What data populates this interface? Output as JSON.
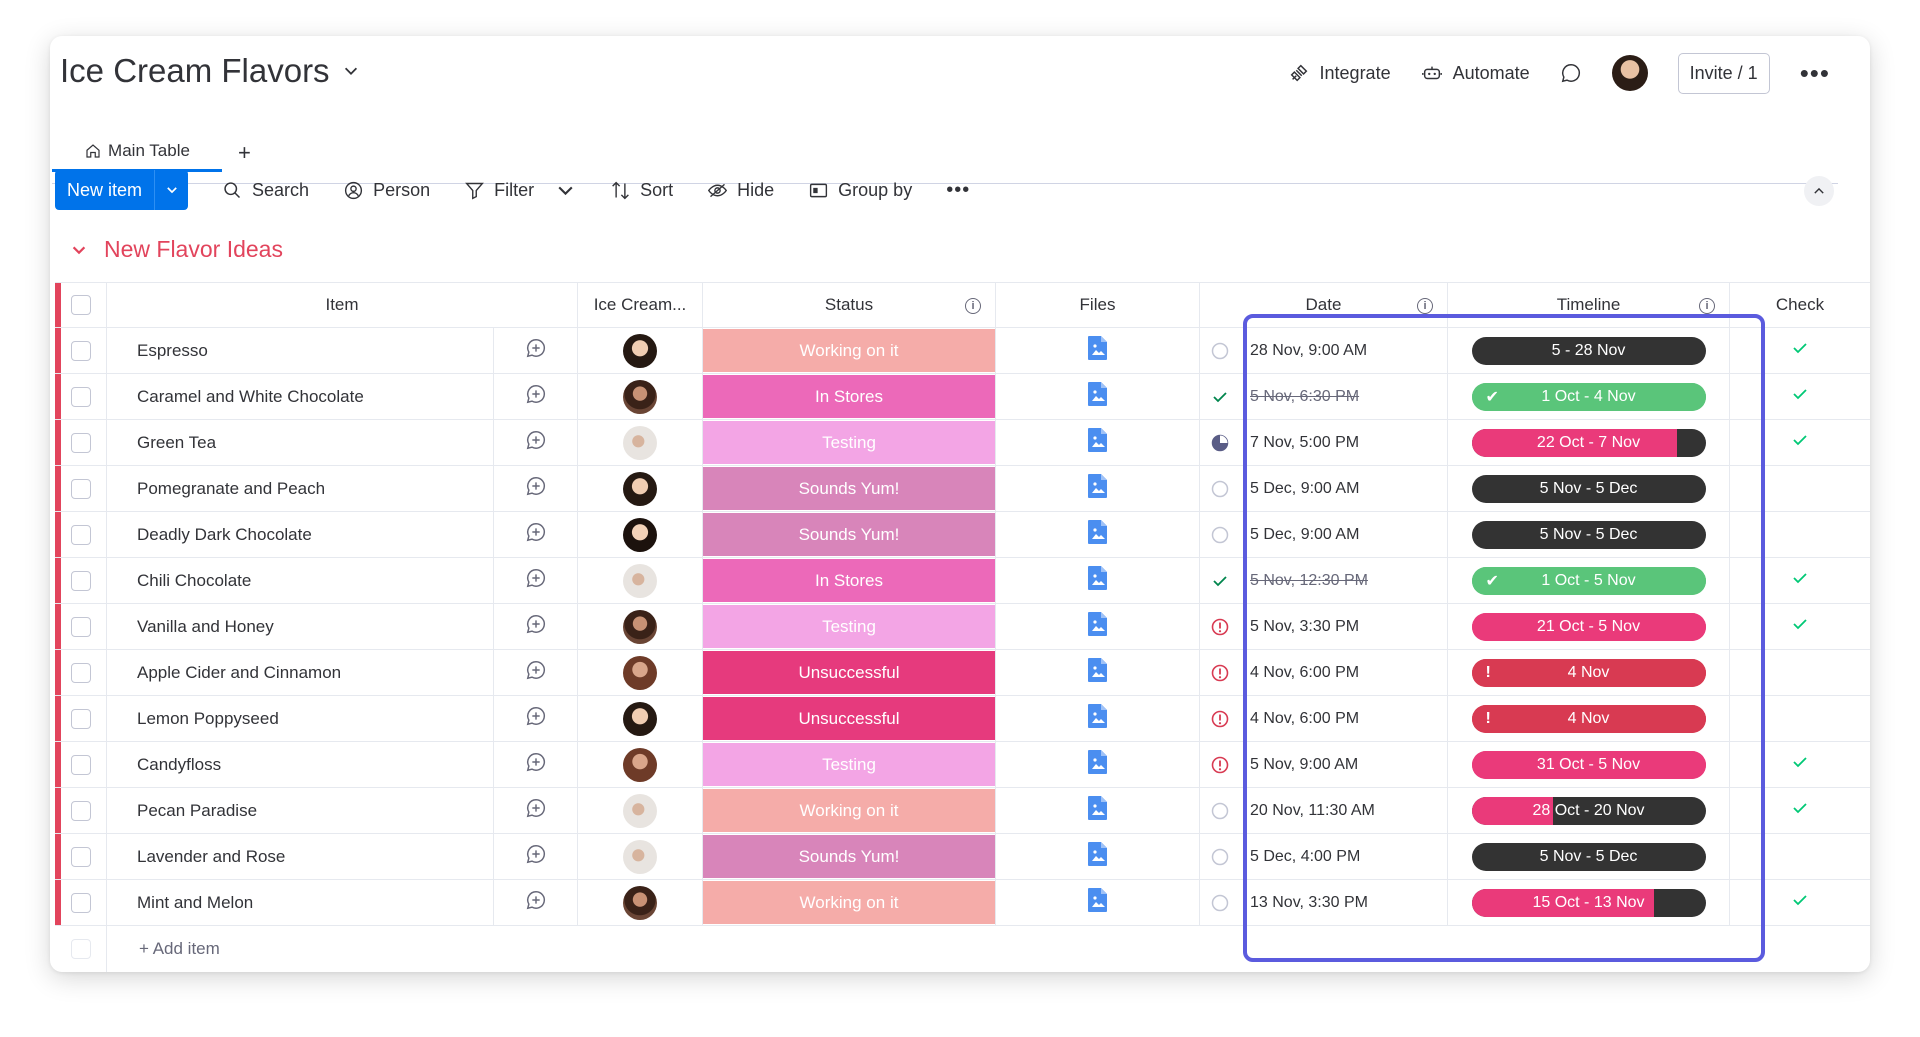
{
  "board": {
    "title": "Ice Cream Flavors"
  },
  "header": {
    "integrate": "Integrate",
    "automate": "Automate",
    "invite": "Invite / 1"
  },
  "tabs": {
    "main_table": "Main Table",
    "add": "+"
  },
  "toolbar": {
    "new_item": "New item",
    "search": "Search",
    "person": "Person",
    "filter": "Filter",
    "sort": "Sort",
    "hide": "Hide",
    "group_by": "Group by"
  },
  "group": {
    "title": "New Flavor Ideas",
    "color": "#e2445c",
    "add_item": "+ Add item"
  },
  "columns": {
    "item": "Item",
    "ice": "Ice Cream...",
    "status": "Status",
    "files": "Files",
    "date": "Date",
    "timeline": "Timeline",
    "check": "Check"
  },
  "status_colors": {
    "Working on it": "#f5aca9",
    "In Stores": "#ec69b9",
    "Testing": "#f3a5e5",
    "Sounds Yum!": "#d885ba",
    "Unsuccessful": "#e63a7d"
  },
  "rows": [
    {
      "item": "Espresso",
      "avatar": "av-a",
      "status": "Working on it",
      "date": "28 Nov, 9:00 AM",
      "date_state": "empty",
      "timeline": "5 - 28 Nov",
      "tl_color": "#333333",
      "tl_progress": 0,
      "tl_icon": "",
      "check": true
    },
    {
      "item": "Caramel and White Chocolate",
      "avatar": "av-b",
      "status": "In Stores",
      "date": "5 Nov, 6:30 PM",
      "date_state": "done",
      "timeline": "1 Oct - 4 Nov",
      "tl_color": "#5ac57a",
      "tl_progress": 1,
      "tl_icon": "check",
      "check": true
    },
    {
      "item": "Green Tea",
      "avatar": "av-c",
      "status": "Testing",
      "date": "7 Nov, 5:00 PM",
      "date_state": "partial",
      "timeline": "22 Oct - 7 Nov",
      "tl_color": "#ea3a7a",
      "tl_progress": 0.88,
      "tl_icon": "",
      "check": true
    },
    {
      "item": "Pomegranate and Peach",
      "avatar": "av-a",
      "status": "Sounds Yum!",
      "date": "5 Dec, 9:00 AM",
      "date_state": "empty",
      "timeline": "5 Nov - 5 Dec",
      "tl_color": "#333333",
      "tl_progress": 0,
      "tl_icon": "",
      "check": false
    },
    {
      "item": "Deadly Dark Chocolate",
      "avatar": "av-e",
      "status": "Sounds Yum!",
      "date": "5 Dec, 9:00 AM",
      "date_state": "empty",
      "timeline": "5 Nov - 5 Dec",
      "tl_color": "#333333",
      "tl_progress": 0,
      "tl_icon": "",
      "check": false
    },
    {
      "item": "Chili Chocolate",
      "avatar": "av-c",
      "status": "In Stores",
      "date": "5 Nov, 12:30 PM",
      "date_state": "done",
      "timeline": "1 Oct - 5 Nov",
      "tl_color": "#5ac57a",
      "tl_progress": 1,
      "tl_icon": "check",
      "check": true
    },
    {
      "item": "Vanilla and Honey",
      "avatar": "av-b",
      "status": "Testing",
      "date": "5 Nov, 3:30 PM",
      "date_state": "overdue",
      "timeline": "21 Oct - 5 Nov",
      "tl_color": "#ea3a7a",
      "tl_progress": 1,
      "tl_icon": "",
      "check": true
    },
    {
      "item": "Apple Cider and Cinnamon",
      "avatar": "av-d",
      "status": "Unsuccessful",
      "date": "4 Nov, 6:00 PM",
      "date_state": "overdue",
      "timeline": "4 Nov",
      "tl_color": "#d83a52",
      "tl_progress": 1,
      "tl_icon": "alert",
      "check": false
    },
    {
      "item": "Lemon Poppyseed",
      "avatar": "av-a",
      "status": "Unsuccessful",
      "date": "4 Nov, 6:00 PM",
      "date_state": "overdue",
      "timeline": "4 Nov",
      "tl_color": "#d83a52",
      "tl_progress": 1,
      "tl_icon": "alert",
      "check": false
    },
    {
      "item": "Candyfloss",
      "avatar": "av-d",
      "status": "Testing",
      "date": "5 Nov, 9:00 AM",
      "date_state": "overdue",
      "timeline": "31 Oct - 5 Nov",
      "tl_color": "#ea3a7a",
      "tl_progress": 1,
      "tl_icon": "",
      "check": true
    },
    {
      "item": "Pecan Paradise",
      "avatar": "av-c",
      "status": "Working on it",
      "date": "20 Nov, 11:30 AM",
      "date_state": "empty",
      "timeline": "28 Oct - 20 Nov",
      "tl_color": "#ea3a7a",
      "tl_progress": 0.35,
      "tl_icon": "",
      "check": true
    },
    {
      "item": "Lavender and Rose",
      "avatar": "av-c",
      "status": "Sounds Yum!",
      "date": "5 Dec, 4:00 PM",
      "date_state": "empty",
      "timeline": "5 Nov - 5 Dec",
      "tl_color": "#333333",
      "tl_progress": 0,
      "tl_icon": "",
      "check": false
    },
    {
      "item": "Mint and Melon",
      "avatar": "av-b",
      "status": "Working on it",
      "date": "13 Nov, 3:30 PM",
      "date_state": "empty",
      "timeline": "15 Oct - 13 Nov",
      "tl_color": "#ea3a7a",
      "tl_progress": 0.78,
      "tl_icon": "",
      "check": true
    }
  ]
}
